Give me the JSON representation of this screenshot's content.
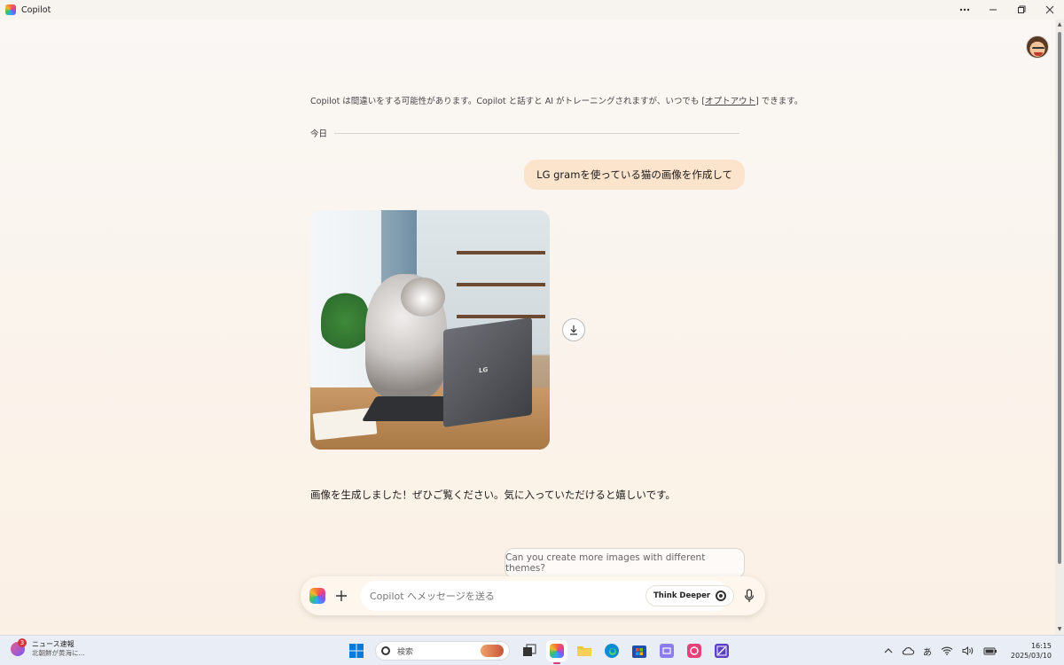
{
  "window": {
    "title": "Copilot"
  },
  "header": {
    "avatar_icon": "user-avatar-icon"
  },
  "chat": {
    "disclaimer_pre": "Copilot は間違いをする可能性があります。Copilot と話すと AI がトレーニングされますが、いつでも [",
    "disclaimer_link": "オプトアウト",
    "disclaimer_post": "] できます。",
    "date_label": "今日",
    "user_message": "LG gramを使っている猫の画像を作成して",
    "image_laptop_logo": "LG",
    "assistant_reply": "画像を生成しました！ぜひご覧ください。気に入っていただけると嬉しいです。",
    "suggestion": "Can you create more images with different themes?"
  },
  "composer": {
    "placeholder": "Copilot へメッセージを送る",
    "think_label": "Think Deeper"
  },
  "taskbar": {
    "news_badge": "3",
    "news_title": "ニュース速報",
    "news_sub": "北朝鮮が黄海に...",
    "search_label": "検索",
    "ime": "あ",
    "time": "16:15",
    "date": "2025/03/10"
  },
  "colors": {
    "user_bubble": "#fce3cc",
    "background": "#faf4ee",
    "taskbar": "#e9eef6",
    "accent": "#d23a7a"
  }
}
